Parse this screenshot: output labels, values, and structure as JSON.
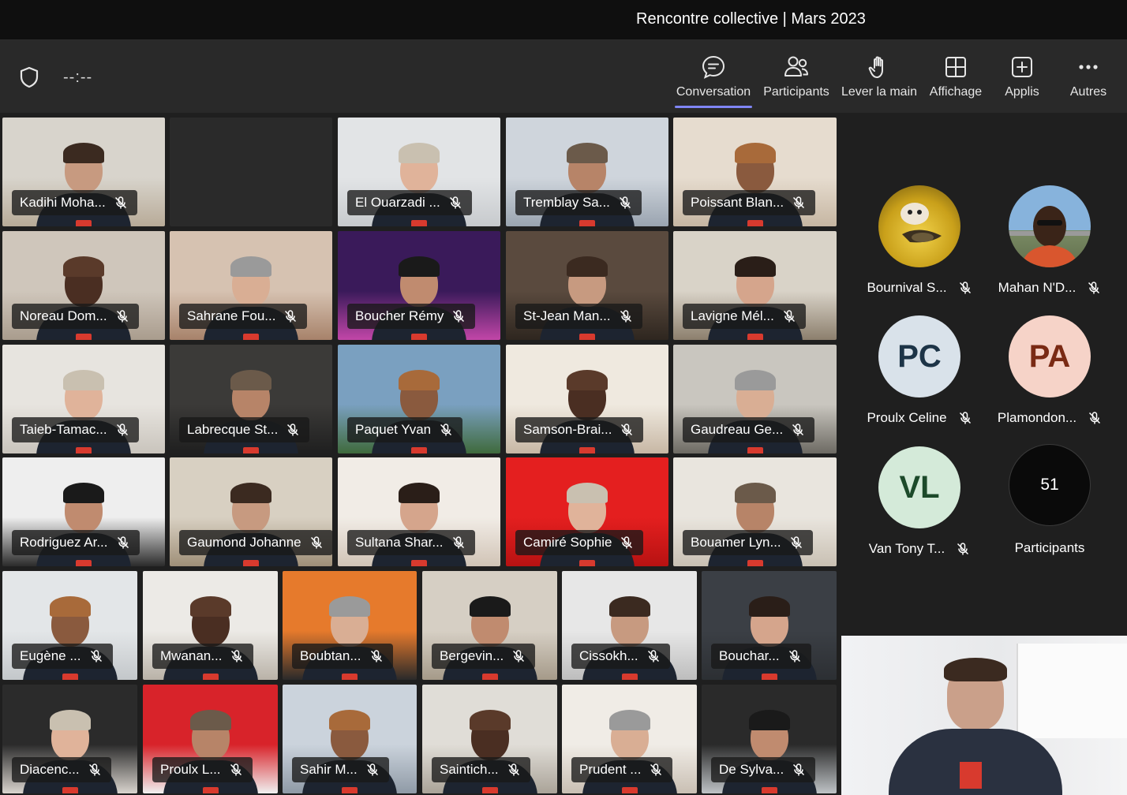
{
  "meeting": {
    "title": "Rencontre collective | Mars 2023",
    "timer": "--:--"
  },
  "toolbar": {
    "buttons": [
      {
        "label": "Conversation",
        "icon": "chat-icon",
        "active": true
      },
      {
        "label": "Participants",
        "icon": "people-icon",
        "active": false
      },
      {
        "label": "Lever la main",
        "icon": "raise-hand-icon",
        "active": false
      },
      {
        "label": "Affichage",
        "icon": "layout-grid-icon",
        "active": false
      },
      {
        "label": "Applis",
        "icon": "add-app-icon",
        "active": false
      },
      {
        "label": "Autres",
        "icon": "more-icon",
        "active": false
      }
    ]
  },
  "grid": {
    "rows": [
      [
        "Kadihi Moha...",
        "",
        "El Ouarzadi ...",
        "Tremblay Sa...",
        "Poissant Blan..."
      ],
      [
        "Noreau Dom...",
        "Sahrane Fou...",
        "Boucher Rémy",
        "St-Jean Man...",
        "Lavigne Mél..."
      ],
      [
        "Taieb-Tamac...",
        "Labrecque St...",
        "Paquet Yvan",
        "Samson-Brai...",
        "Gaudreau Ge..."
      ],
      [
        "Rodriguez Ar...",
        "Gaumond Johanne",
        "Sultana Shar...",
        "Camiré Sophie",
        "Bouamer Lyn..."
      ],
      [
        "Eugène ...",
        "Mwanan...",
        "Boubtan...",
        "Bergevin...",
        "Cissokh...",
        "Bouchar..."
      ],
      [
        "Diacenc...",
        "Proulx L...",
        "Sahir M...",
        "Saintich...",
        "Prudent ...",
        "De Sylva..."
      ]
    ]
  },
  "roster": {
    "people": [
      {
        "name": "Bournival S...",
        "initials": "",
        "avatar_type": "photo",
        "bg": "#d9b526"
      },
      {
        "name": "Mahan N'D...",
        "initials": "",
        "avatar_type": "photo",
        "bg": "#7aa6cf"
      },
      {
        "name": "Proulx Celine",
        "initials": "PC",
        "avatar_type": "initials",
        "bg": "#d9e2ea",
        "fg": "#1d3447"
      },
      {
        "name": "Plamondon...",
        "initials": "PA",
        "avatar_type": "initials",
        "bg": "#f6d3c8",
        "fg": "#7a2a14"
      },
      {
        "name": "Van Tony T...",
        "initials": "VL",
        "avatar_type": "initials",
        "bg": "#d4ead9",
        "fg": "#1c4a2a"
      }
    ],
    "overflow_count": "51",
    "overflow_label": "Participants"
  },
  "colors": {
    "accent": "#7f85f5",
    "titlebar": "#0f0f0f",
    "toolbar": "#292929",
    "background": "#1f1f1f"
  }
}
